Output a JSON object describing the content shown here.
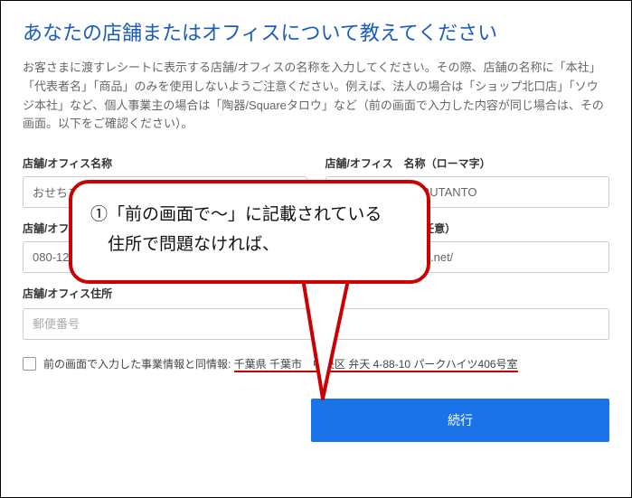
{
  "page": {
    "title": "あなたの店舗またはオフィスについて教えてください",
    "description": "お客さまに渡すレシートに表示する店舗/オフィスの名称を入力してください。その際、店舗の名称に「本社」「代表者名」「商品」のみを使用しないようご注意ください。例えば、法人の場合は「ショップ北口店」「ソウジ本社」など、個人事業主の場合は「陶器/Squareタロウ」など（前の画面で入力した内容が同じ場合は、その画面。以下をご確認ください）。"
  },
  "fields": {
    "name_label": "店舗/オフィス名称",
    "name_value": "おせちコンサル",
    "roman_label": "店舗/オフィス　名称（ローマ字）",
    "roman_value": "OSECHIKONSARUTANTO",
    "phone_label": "店舗/オフィス電話番号",
    "phone_value": "080-1234-1234",
    "url_label": "ウェブサイトURL（任意）",
    "url_value": "https://osechi-tech.net/",
    "address_label": "店舗/オフィス住所",
    "postal_placeholder": "郵便番号"
  },
  "checkbox": {
    "label_prefix": "前の画面で入力した事業情報と同情報: ",
    "address": "千葉県 千葉市　中央区 弁天 4-88-10 パークハイツ406号室"
  },
  "callout": {
    "line1": "①「前の画面で〜」に記載されている",
    "line2": "　住所で問題なければ、"
  },
  "buttons": {
    "continue": "続行"
  }
}
